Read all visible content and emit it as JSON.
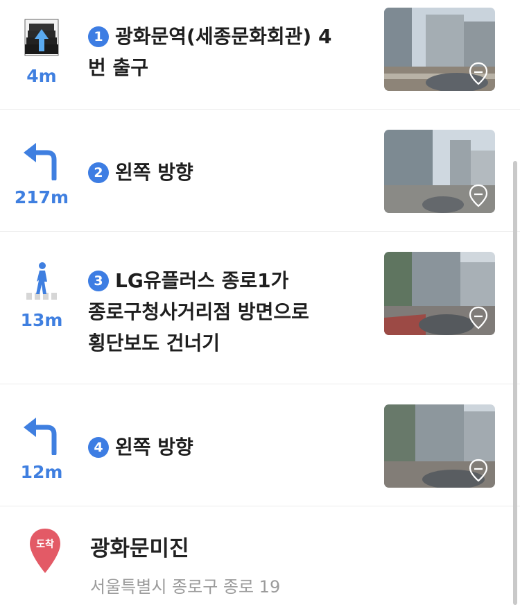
{
  "steps": [
    {
      "number": "1",
      "distance": "4m",
      "icon": "stairs-up-icon",
      "line1": "광화문역(세종문화회관) 4",
      "line2": "번 출구",
      "line3": ""
    },
    {
      "number": "2",
      "distance": "217m",
      "icon": "turn-left-icon",
      "line1": "왼쪽 방향",
      "line2": "",
      "line3": ""
    },
    {
      "number": "3",
      "distance": "13m",
      "icon": "pedestrian-crosswalk-icon",
      "line1": "LG유플러스 종로1가",
      "line2": "종로구청사거리점 방면으로",
      "line3": "횡단보도 건너기"
    },
    {
      "number": "4",
      "distance": "12m",
      "icon": "turn-left-icon",
      "line1": "왼쪽 방향",
      "line2": "",
      "line3": ""
    }
  ],
  "destination": {
    "pin_label": "도착",
    "name": "광화문미진",
    "address": "서울특별시 종로구 종로 19"
  },
  "colors": {
    "accent": "#3d7de3",
    "pin": "#e35a66",
    "secondary_text": "#9b9b9b"
  }
}
